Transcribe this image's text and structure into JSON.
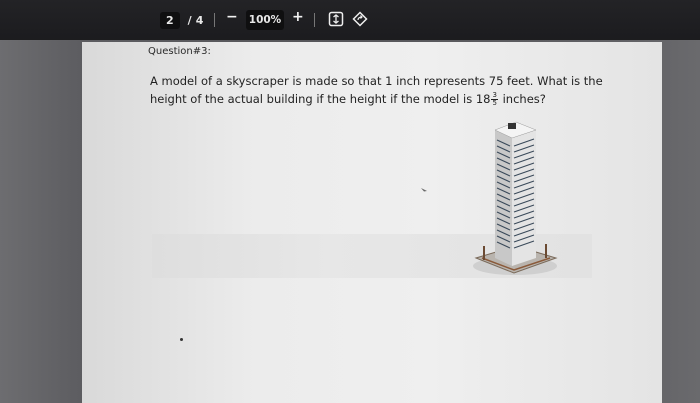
{
  "toolbar": {
    "current_page": "2",
    "page_separator": "/",
    "total_pages": "4",
    "zoom_out_label": "−",
    "zoom_level": "100%",
    "zoom_in_label": "+"
  },
  "document": {
    "question_label": "Question#3:",
    "question_text_before": "A model of a skyscraper is made so that 1 inch represents 75 feet. What is the height of the actual building if the height if the model is 18",
    "fraction_numerator": "3",
    "fraction_denominator": "5",
    "question_text_after": " inches?"
  },
  "icons": [
    "fit-page-icon",
    "rotate-icon",
    "skyscraper-image"
  ]
}
